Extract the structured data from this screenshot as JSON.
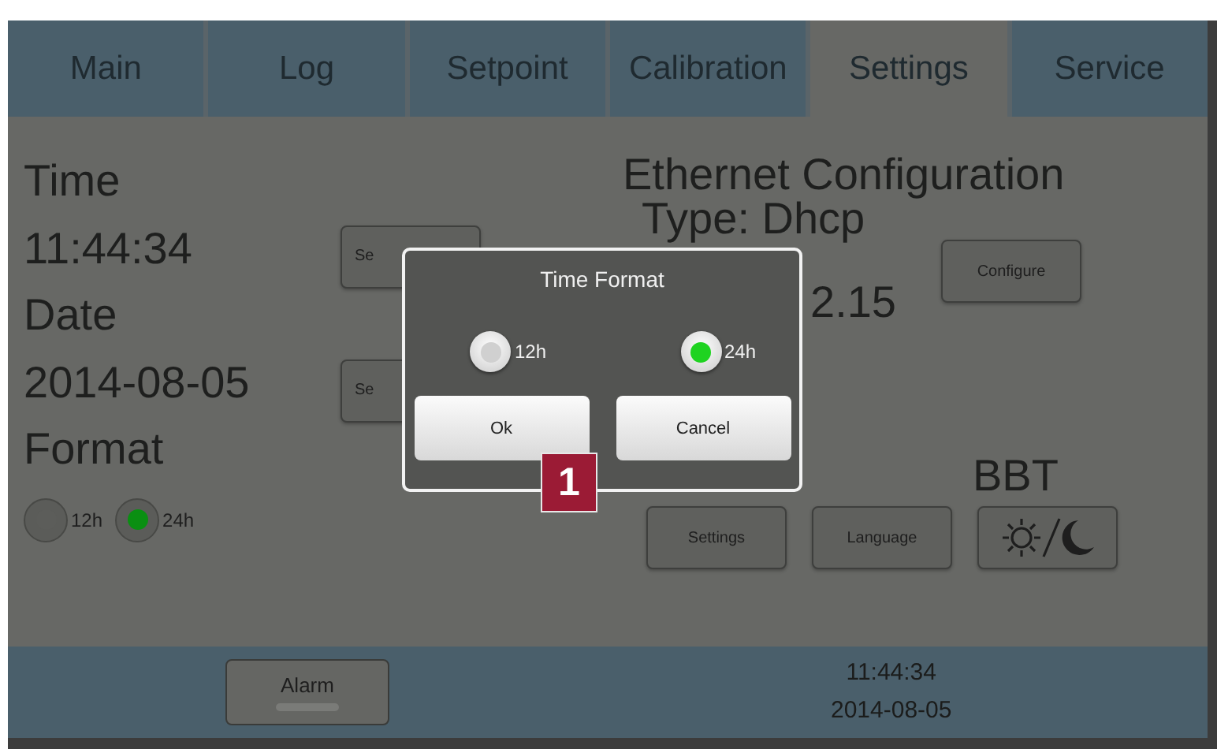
{
  "tabs": [
    {
      "label": "Main",
      "selected": false
    },
    {
      "label": "Log",
      "selected": false
    },
    {
      "label": "Setpoint",
      "selected": false
    },
    {
      "label": "Calibration",
      "selected": false
    },
    {
      "label": "Settings",
      "selected": true
    },
    {
      "label": "Service",
      "selected": false
    }
  ],
  "time": {
    "heading": "Time",
    "value": "11:44:34",
    "button": "Se"
  },
  "date": {
    "heading": "Date",
    "value": "2014-08-05",
    "button": "Se"
  },
  "format": {
    "heading": "Format",
    "options": [
      {
        "label": "12h",
        "selected": false
      },
      {
        "label": "24h",
        "selected": true
      }
    ]
  },
  "ethernet": {
    "heading": "Ethernet Configuration",
    "type": "Type: Dhcp",
    "ip": "2.15",
    "configure_button": "Configure"
  },
  "bbt": {
    "heading": "BBT"
  },
  "bottom_buttons": [
    {
      "kind": "text",
      "label": "Settings"
    },
    {
      "kind": "text",
      "label": "Language"
    },
    {
      "kind": "day-night"
    }
  ],
  "dialog": {
    "title": "Time Format",
    "options": [
      {
        "label": "12h",
        "selected": false
      },
      {
        "label": "24h",
        "selected": true
      }
    ],
    "buttons": [
      "Ok",
      "Cancel"
    ]
  },
  "callout": "1",
  "status_bar": {
    "alarm_button": "Alarm",
    "time": "11:44:34",
    "date": "2014-08-05"
  }
}
